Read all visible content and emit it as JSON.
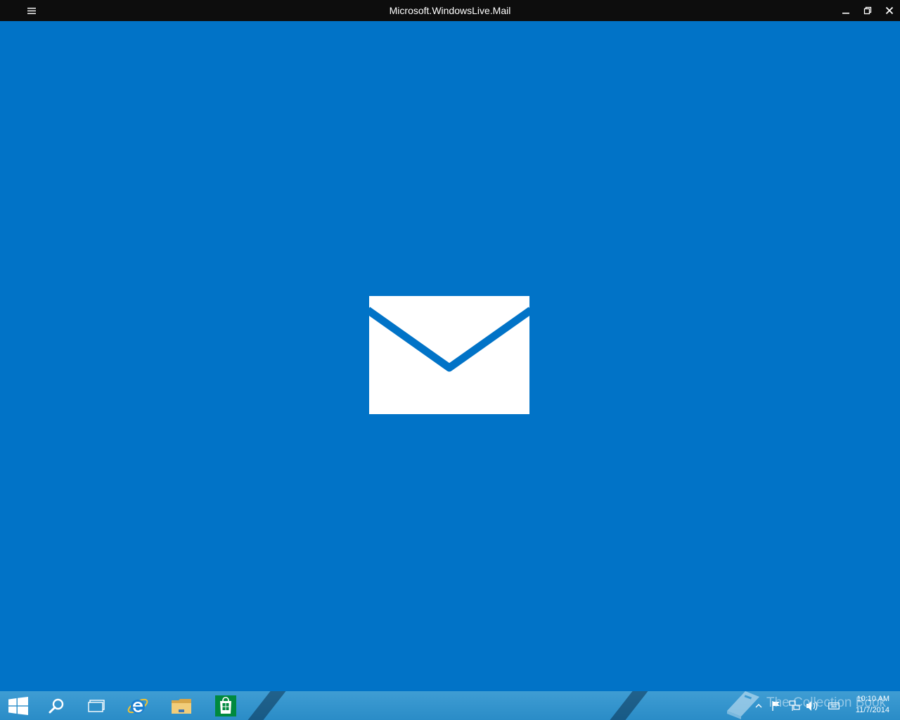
{
  "window": {
    "title": "Microsoft.WindowsLive.Mail",
    "menu_icon": "hamburger-icon",
    "controls": [
      "minimize-icon",
      "restore-icon",
      "close-icon"
    ]
  },
  "splash": {
    "icon": "mail-envelope-icon",
    "background_color": "#0173c7",
    "icon_color": "#ffffff"
  },
  "taskbar": {
    "items": [
      "windows-start-icon",
      "search-icon",
      "task-view-icon",
      "internet-explorer-icon",
      "file-explorer-icon",
      "store-icon"
    ],
    "tray": [
      "chevron-up-icon",
      "flag-icon",
      "network-icon",
      "volume-icon",
      "keyboard-icon"
    ],
    "watermark": "The Collection Book",
    "clock": {
      "time": "10:10 AM",
      "date": "11/7/2014"
    }
  }
}
